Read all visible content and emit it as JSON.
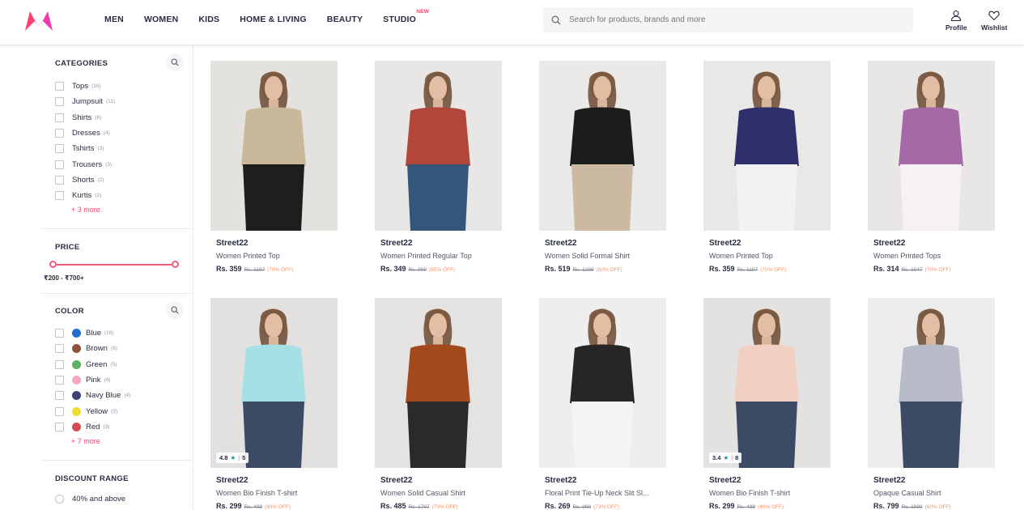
{
  "header": {
    "nav": [
      {
        "label": "MEN",
        "badge": ""
      },
      {
        "label": "WOMEN",
        "badge": ""
      },
      {
        "label": "KIDS",
        "badge": ""
      },
      {
        "label": "HOME & LIVING",
        "badge": ""
      },
      {
        "label": "BEAUTY",
        "badge": ""
      },
      {
        "label": "STUDIO",
        "badge": "NEW"
      }
    ],
    "search_placeholder": "Search for products, brands and more",
    "profile_label": "Profile",
    "wishlist_label": "Wishlist",
    "logo_colors": [
      "#ff3f6c",
      "#f13ab1",
      "#ff905a"
    ]
  },
  "filters": {
    "categories": {
      "title": "CATEGORIES",
      "items": [
        {
          "label": "Tops",
          "count": "(16)"
        },
        {
          "label": "Jumpsuit",
          "count": "(11)"
        },
        {
          "label": "Shirts",
          "count": "(6)"
        },
        {
          "label": "Dresses",
          "count": "(4)"
        },
        {
          "label": "Tshirts",
          "count": "(3)"
        },
        {
          "label": "Trousers",
          "count": "(3)"
        },
        {
          "label": "Shorts",
          "count": "(2)"
        },
        {
          "label": "Kurtis",
          "count": "(2)"
        }
      ],
      "more": "+ 3 more"
    },
    "price": {
      "title": "PRICE",
      "range_label": "₹200 - ₹700+",
      "slider_color": "#f05c7e"
    },
    "color": {
      "title": "COLOR",
      "items": [
        {
          "label": "Blue",
          "count": "(16)",
          "hex": "#1f6fd3"
        },
        {
          "label": "Brown",
          "count": "(6)",
          "hex": "#915039"
        },
        {
          "label": "Green",
          "count": "(5)",
          "hex": "#5eb160"
        },
        {
          "label": "Pink",
          "count": "(4)",
          "hex": "#f1a9c4"
        },
        {
          "label": "Navy Blue",
          "count": "(4)",
          "hex": "#3c4477"
        },
        {
          "label": "Yellow",
          "count": "(3)",
          "hex": "#eedd2a"
        },
        {
          "label": "Red",
          "count": "(3)",
          "hex": "#d34b56"
        }
      ],
      "more": "+ 7 more"
    },
    "discount": {
      "title": "DISCOUNT RANGE",
      "options": [
        "40% and above"
      ]
    }
  },
  "products": [
    {
      "brand": "Street22",
      "name": "Women Printed Top",
      "price": "Rs. 359",
      "mrp": "Rs. 1197",
      "off": "(70% OFF)",
      "rating": "",
      "reviews": "",
      "palette": [
        "#e4e2df",
        "#c9b89a",
        "#1e1e1e"
      ]
    },
    {
      "brand": "Street22",
      "name": "Women Printed Regular Top",
      "price": "Rs. 349",
      "mrp": "Rs. 999",
      "off": "(65% OFF)",
      "rating": "",
      "reviews": "",
      "palette": [
        "#e9e7e5",
        "#b3463a",
        "#34567a"
      ]
    },
    {
      "brand": "Street22",
      "name": "Women Solid Formal Shirt",
      "price": "Rs. 519",
      "mrp": "Rs. 1299",
      "off": "(60% OFF)",
      "rating": "",
      "reviews": "",
      "palette": [
        "#ebe9e7",
        "#1c1c1c",
        "#cbb9a1"
      ]
    },
    {
      "brand": "Street22",
      "name": "Women Printed Top",
      "price": "Rs. 359",
      "mrp": "Rs. 1197",
      "off": "(70% OFF)",
      "rating": "",
      "reviews": "",
      "palette": [
        "#e9e8e6",
        "#2f2f6b",
        "#f2f2f2"
      ]
    },
    {
      "brand": "Street22",
      "name": "Women Printed Tops",
      "price": "Rs. 314",
      "mrp": "Rs. 1047",
      "off": "(70% OFF)",
      "rating": "",
      "reviews": "",
      "palette": [
        "#e8e7e5",
        "#a569a8",
        "#f5f1f5"
      ]
    },
    {
      "brand": "Street22",
      "name": "Women Bio Finish T-shirt",
      "price": "Rs. 299",
      "mrp": "Rs. 499",
      "off": "(40% OFF)",
      "rating": "4.8",
      "reviews": "5",
      "palette": [
        "#e3e1df",
        "#a6e0e4",
        "#3c4a66"
      ]
    },
    {
      "brand": "Street22",
      "name": "Women Solid Casual Shirt",
      "price": "Rs. 485",
      "mrp": "Rs. 1797",
      "off": "(73% OFF)",
      "rating": "",
      "reviews": "",
      "palette": [
        "#e5e3e1",
        "#a24a1d",
        "#2a2a2a"
      ]
    },
    {
      "brand": "Street22",
      "name": "Floral Print Tie-Up Neck Slit Sl...",
      "price": "Rs. 269",
      "mrp": "Rs. 999",
      "off": "(73% OFF)",
      "rating": "",
      "reviews": "",
      "palette": [
        "#eeeeee",
        "#262626",
        "#f4f4f4"
      ]
    },
    {
      "brand": "Street22",
      "name": "Women Bio Finish T-shirt",
      "price": "Rs. 299",
      "mrp": "Rs. 499",
      "off": "(40% OFF)",
      "rating": "3.4",
      "reviews": "8",
      "palette": [
        "#e4e2e0",
        "#f1cfc3",
        "#3c4a66"
      ]
    },
    {
      "brand": "Street22",
      "name": "Opaque Casual Shirt",
      "price": "Rs. 799",
      "mrp": "Rs. 1999",
      "off": "(60% OFF)",
      "rating": "",
      "reviews": "",
      "palette": [
        "#ececec",
        "#b8bcc8",
        "#3c4a66"
      ]
    }
  ]
}
